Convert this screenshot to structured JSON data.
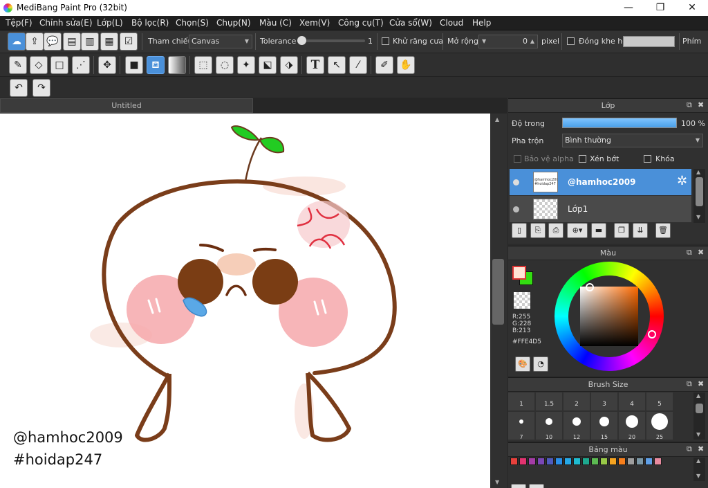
{
  "window": {
    "title": "MediBang Paint Pro (32bit)",
    "minimize": "—",
    "maximize": "❐",
    "close": "✕"
  },
  "menu": [
    "Tệp(F)",
    "Chỉnh sửa(E)",
    "Lớp(L)",
    "Bộ lọc(R)",
    "Chọn(S)",
    "Chụp(N)",
    "Màu (C)",
    "Xem(V)",
    "Công cụ(T)",
    "Cửa sổ(W)",
    "Cloud",
    "Help"
  ],
  "options": {
    "reference_label": "Tham chiếu",
    "reference_value": "Canvas",
    "tolerance_label": "Tolerance",
    "tolerance_value": "1",
    "antialias_label": "Khử răng cưa",
    "expand_label": "Mở rộng",
    "expand_value": "0",
    "expand_unit": "pixel",
    "close_gap_label": "Đóng khe hở",
    "shortcut_label": "Phím"
  },
  "document": {
    "tab_title": "Untitled"
  },
  "canvas_text": {
    "watermark_line1": "@hamhoc2009",
    "watermark_line2": "#hoidap247"
  },
  "layer_panel": {
    "title": "Lớp",
    "opacity_label": "Độ trong",
    "opacity_value": "100 %",
    "opacity_level": 1.0,
    "blend_label": "Pha trộn",
    "blend_value": "Bình thường",
    "protect_alpha": "Bảo vệ alpha",
    "clipping": "Xén bớt",
    "lock": "Khóa",
    "layers": [
      {
        "name": "@hamhoc2009",
        "thumb_text": "@hamhoc2009 #hoidap247",
        "selected": true
      },
      {
        "name": "Lớp1",
        "selected": false
      }
    ]
  },
  "color_panel": {
    "title": "Màu",
    "r": "R:255",
    "g": "G:228",
    "b": "B:213",
    "hex": "#FFE4D5",
    "fg_color": "#FFE4D5",
    "bg_color": "#33DD11"
  },
  "brush_panel": {
    "title": "Brush Size",
    "sizes": [
      "1",
      "1.5",
      "2",
      "3",
      "4",
      "5"
    ],
    "next_sizes": [
      "7",
      "10",
      "12",
      "15",
      "20",
      "25"
    ]
  },
  "palette_panel": {
    "title": "Bảng màu",
    "colors": [
      "#e8413c",
      "#e23370",
      "#a43ca6",
      "#7a47b5",
      "#4f5bbd",
      "#2a8fe8",
      "#26a9e8",
      "#1fbcd1",
      "#1ea98f",
      "#5cba52",
      "#98c847",
      "#f5a320",
      "#f77f1c",
      "#9e9e9e",
      "#7c98a7",
      "#5fa0e8",
      "#e88ba0"
    ]
  },
  "tools_toolbar": [
    {
      "name": "brush-tool-icon",
      "glyph": "✎"
    },
    {
      "name": "eraser-tool-icon",
      "glyph": "◇"
    },
    {
      "name": "shape-tool-icon",
      "glyph": "□"
    },
    {
      "name": "dot-tool-icon",
      "glyph": "⋰"
    },
    {
      "name": "move-tool-icon",
      "glyph": "✥"
    },
    {
      "name": "fill-rect-tool-icon",
      "glyph": "■"
    },
    {
      "name": "bucket-tool-icon",
      "glyph": "⛾"
    },
    {
      "name": "gradient-tool-icon",
      "glyph": "▦"
    },
    {
      "name": "select-rect-tool-icon",
      "glyph": "⬚"
    },
    {
      "name": "lasso-tool-icon",
      "glyph": "◌"
    },
    {
      "name": "magic-wand-tool-icon",
      "glyph": "✦"
    },
    {
      "name": "select-pen-tool-icon",
      "glyph": "⬕"
    },
    {
      "name": "select-eraser-tool-icon",
      "glyph": "⬗"
    },
    {
      "name": "text-tool-icon",
      "glyph": "T"
    },
    {
      "name": "operation-tool-icon",
      "glyph": "↖"
    },
    {
      "name": "pen-tool-icon",
      "glyph": "⁄"
    },
    {
      "name": "eyedropper-tool-icon",
      "glyph": "✐"
    },
    {
      "name": "hand-tool-icon",
      "glyph": "✋"
    }
  ]
}
